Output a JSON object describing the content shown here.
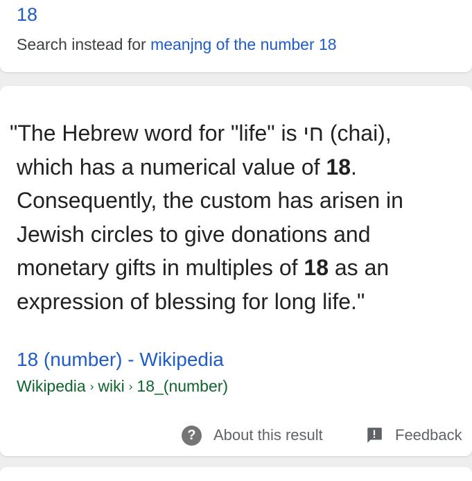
{
  "spelling": {
    "corrected_query": "18",
    "search_instead_prefix": "Search instead for",
    "search_instead_link": "meanjng of the number 18"
  },
  "featured_snippet": {
    "lines": [
      [
        "\"The Hebrew word for \"life\" is חי (chai),"
      ],
      [
        "which has a numerical value of ",
        "18",
        "."
      ],
      [
        "Consequently, the custom has arisen in"
      ],
      [
        "Jewish circles to give donations and"
      ],
      [
        "monetary gifts in multiples of ",
        "18",
        " as an"
      ],
      [
        "expression of blessing for long life.\""
      ]
    ],
    "source_title": "18 (number) - Wikipedia",
    "breadcrumb": [
      "Wikipedia",
      "wiki",
      "18_(number)"
    ],
    "breadcrumb_separator": "›"
  },
  "actions": {
    "about_label": "About this result",
    "feedback_label": "Feedback",
    "about_icon": "help-icon",
    "feedback_icon": "feedback-icon"
  },
  "colors": {
    "link": "#1e5cc8",
    "url_green": "#0d652d",
    "text": "#222222",
    "muted": "#5f6368",
    "background": "#eeeeee"
  }
}
